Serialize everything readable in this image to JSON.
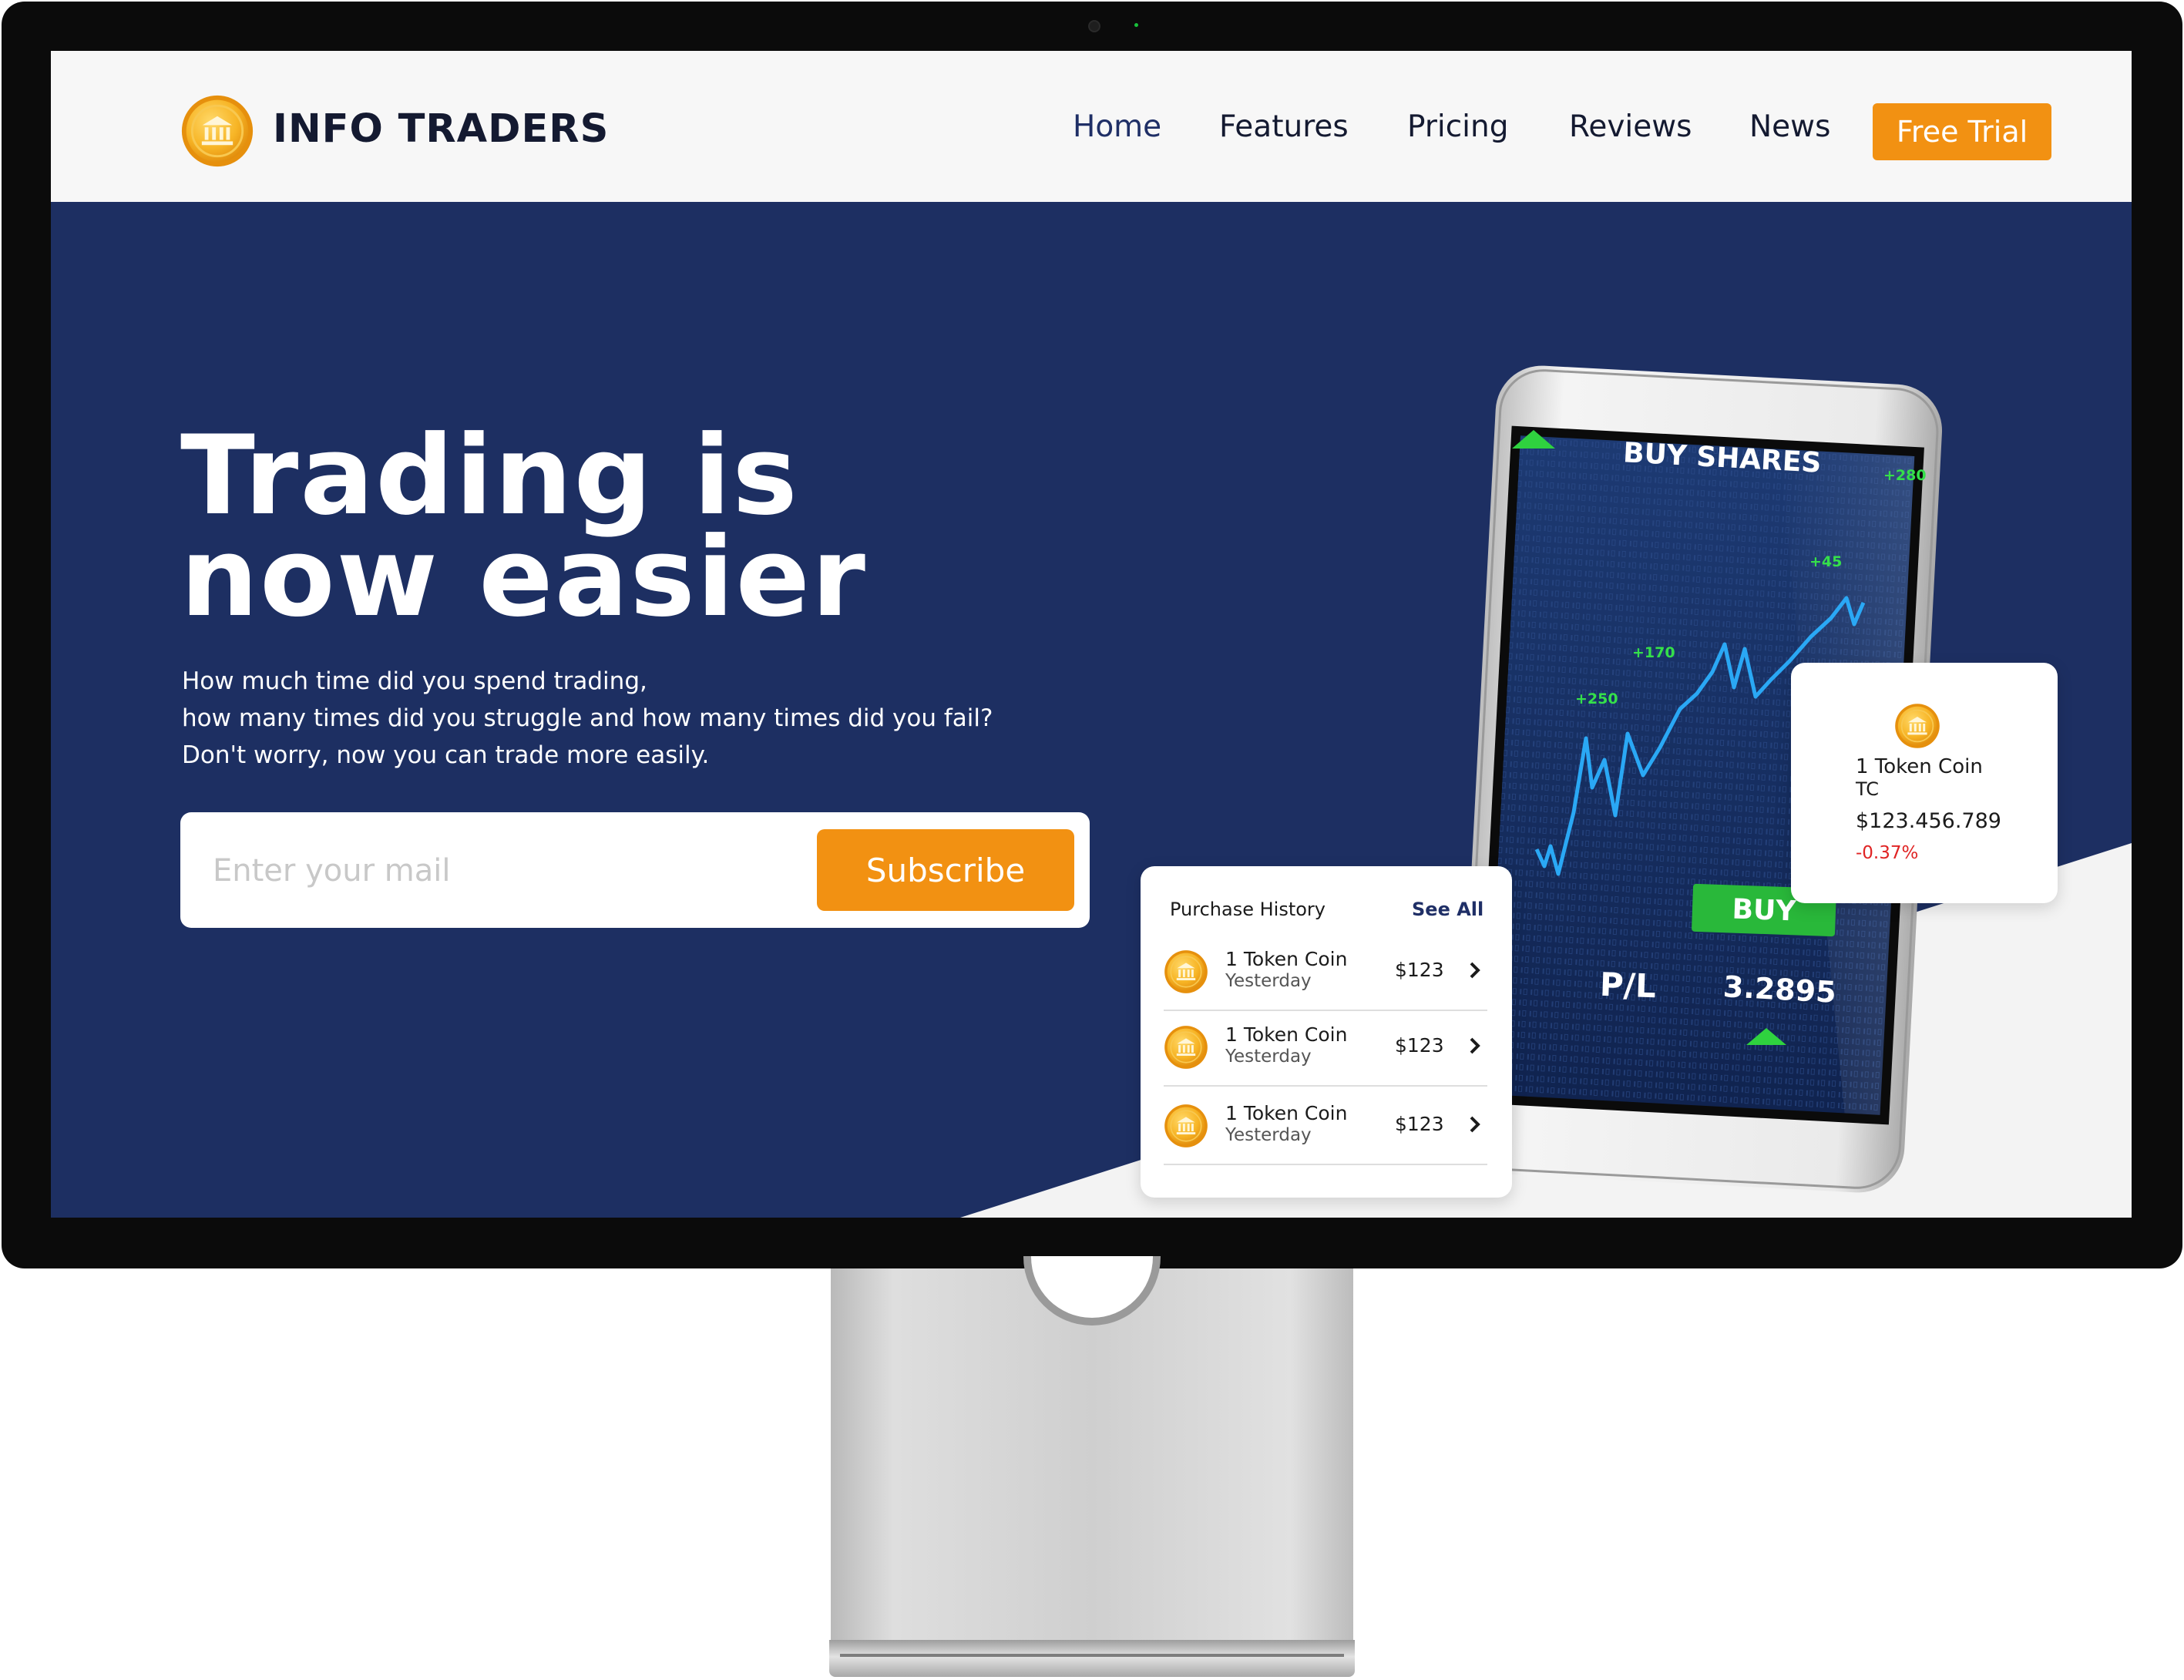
{
  "brand": {
    "name": "INFO TRADERS",
    "logo_icon": "bank-coin-icon"
  },
  "nav": {
    "items": [
      {
        "label": "Home",
        "active": true
      },
      {
        "label": "Features"
      },
      {
        "label": "Pricing"
      },
      {
        "label": "Reviews"
      },
      {
        "label": "News"
      }
    ],
    "cta": "Free Trial"
  },
  "hero": {
    "headline_line1": "Trading is",
    "headline_line2": "now easier",
    "sub_line1": "How much time did you spend trading,",
    "sub_line2": "how many times did you struggle and how many times did you fail?",
    "sub_line3": "Don't worry, now you can trade more easily.",
    "email_placeholder": "Enter your mail",
    "subscribe_label": "Subscribe"
  },
  "phone": {
    "header": "BUY SHARES",
    "chart_labels": [
      "+280",
      "+45",
      "+170",
      "+250"
    ],
    "buy_label": "BUY",
    "pl_label": "P/L",
    "pl_value": "3.2895"
  },
  "purchase_history": {
    "title": "Purchase History",
    "see_all": "See All",
    "rows": [
      {
        "name": "1 Token Coin",
        "time": "Yesterday",
        "price": "$123"
      },
      {
        "name": "1 Token Coin",
        "time": "Yesterday",
        "price": "$123"
      },
      {
        "name": "1 Token Coin",
        "time": "Yesterday",
        "price": "$123"
      }
    ]
  },
  "token_card": {
    "name": "1 Token Coin",
    "symbol": "TC",
    "price": "$123.456.789",
    "change": "-0.37%"
  },
  "colors": {
    "navy": "#1d2f62",
    "accent_orange": "#f29112",
    "chart_blue": "#29a3f0",
    "positive_green": "#2fd23f",
    "negative_red": "#e02424",
    "coin_gold": "#f5a623"
  }
}
